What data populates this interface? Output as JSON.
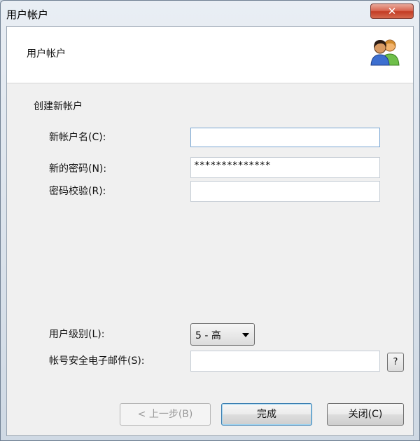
{
  "window": {
    "title": "用户帐户",
    "close_symbol": "✕"
  },
  "header": {
    "title": "用户帐户",
    "icon": "users-icon"
  },
  "form": {
    "section": "创建新帐户",
    "username": {
      "label": "新帐户名(C):",
      "value": ""
    },
    "password": {
      "label": "新的密码(N):",
      "value": "**************"
    },
    "confirm": {
      "label": "密码校验(R):",
      "value": ""
    },
    "level": {
      "label": "用户级别(L):",
      "value": "5 - 高"
    },
    "email": {
      "label": "帐号安全电子邮件(S):",
      "value": ""
    },
    "help_label": "?"
  },
  "buttons": {
    "back": "< 上一步(B)",
    "finish": "完成",
    "close": "关闭(C)"
  }
}
